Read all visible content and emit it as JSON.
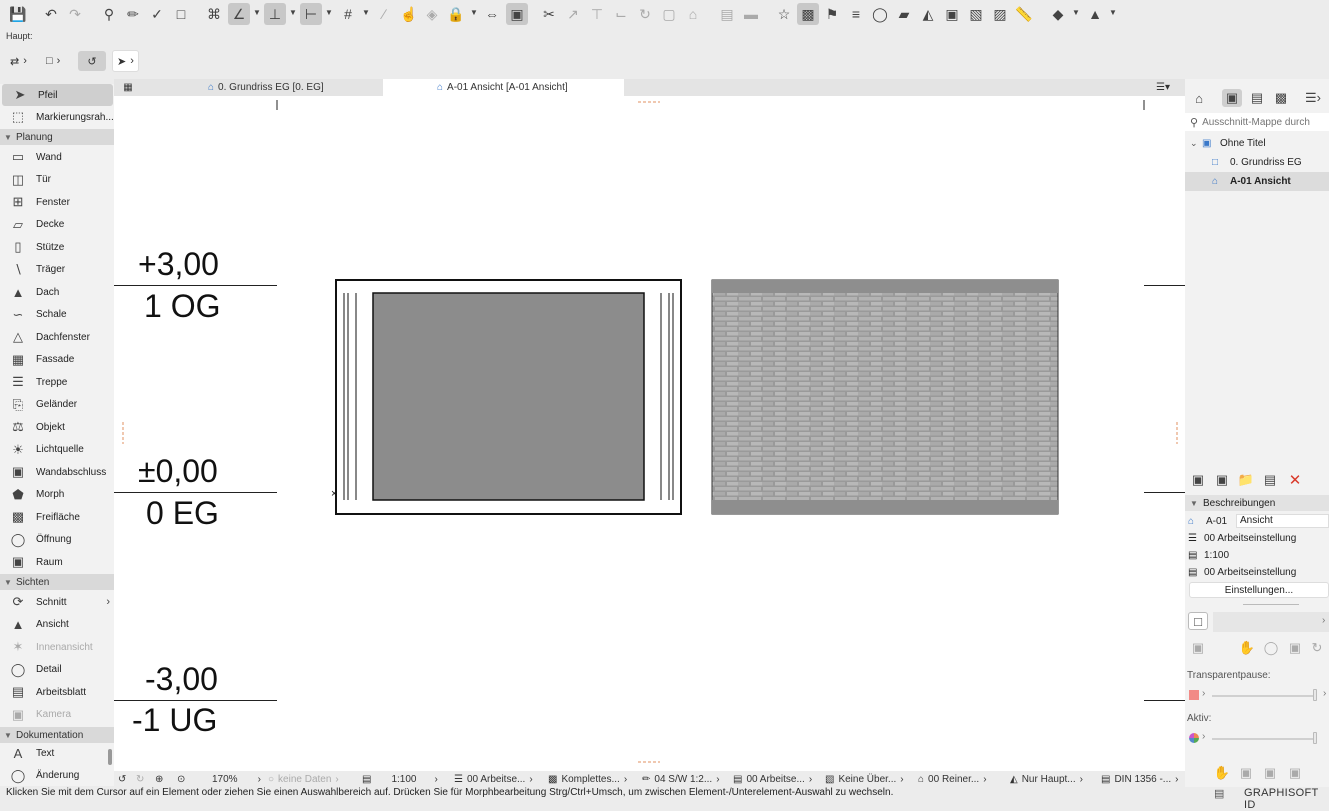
{
  "toolbar": {
    "haupt_label": "Haupt:"
  },
  "toolbox": {
    "top_tools": [
      {
        "label": "Pfeil",
        "icon": "arrow-pointer-icon",
        "selected": true
      },
      {
        "label": "Markierungsrah...",
        "icon": "marquee-icon"
      }
    ],
    "groups": {
      "planung": "Planung",
      "sichten": "Sichten",
      "dokumentation": "Dokumentation"
    },
    "planung_tools": [
      "Wand",
      "Tür",
      "Fenster",
      "Decke",
      "Stütze",
      "Träger",
      "Dach",
      "Schale",
      "Dachfenster",
      "Fassade",
      "Treppe",
      "Geländer",
      "Objekt",
      "Lichtquelle",
      "Wandabschluss",
      "Morph",
      "Freifläche",
      "Öffnung",
      "Raum"
    ],
    "sichten_tools": [
      "Schnitt",
      "Ansicht",
      "Innenansicht",
      "Detail",
      "Arbeitsblatt",
      "Kamera"
    ],
    "dokumentation_tools": [
      "Text",
      "Änderung"
    ]
  },
  "tabs": [
    {
      "label": "0. Grundriss EG [0. EG]",
      "active": false
    },
    {
      "label": "A-01 Ansicht [A-01 Ansicht]",
      "active": true
    }
  ],
  "canvas": {
    "levels": [
      {
        "elevation": "+3,00",
        "name": "1 OG"
      },
      {
        "elevation": "±0,00",
        "name": "0 EG"
      },
      {
        "elevation": "-3,00",
        "name": "-1 UG"
      }
    ]
  },
  "statusbar": {
    "zoom": "170%",
    "no_data": "keine Daten",
    "scale": "1:100",
    "layer_combo": "00 Arbeitse...",
    "model_view": "Komplettes...",
    "pen_set": "04 S/W 1:2...",
    "dimension": "00 Arbeitse...",
    "override": "Keine Über...",
    "renovation": "00 Reiner...",
    "structure": "Nur Haupt...",
    "dimension_std": "DIN 1356 -..."
  },
  "message": "Klicken Sie mit dem Cursor auf ein Element oder ziehen Sie einen Auswahlbereich auf. Drücken Sie für Morphbearbeitung Strg/Ctrl+Umsch, um zwischen Element-/Unterelement-Auswahl zu wechseln.",
  "navigator": {
    "search_placeholder": "Ausschnitt-Mappe durch",
    "tree": [
      {
        "label": "Ohne Titel",
        "level": 0
      },
      {
        "label": "0. Grundriss EG",
        "level": 1
      },
      {
        "label": "A-01 Ansicht",
        "level": 1,
        "selected": true
      }
    ]
  },
  "properties": {
    "section_title": "Beschreibungen",
    "id_value": "A-01",
    "name_value": "Ansicht",
    "layer_combo": "00 Arbeitseinstellung",
    "scale": "1:100",
    "dimension": "00 Arbeitseinstellung",
    "settings_button": "Einstellungen...",
    "transparent_label": "Transparentpause:",
    "active_label": "Aktiv:"
  },
  "brand": "GRAPHISOFT ID",
  "colors": {
    "selected_bg": "#cfcfcf",
    "window_fill": "#8c8c8c",
    "delete_red": "#d93a2b"
  }
}
